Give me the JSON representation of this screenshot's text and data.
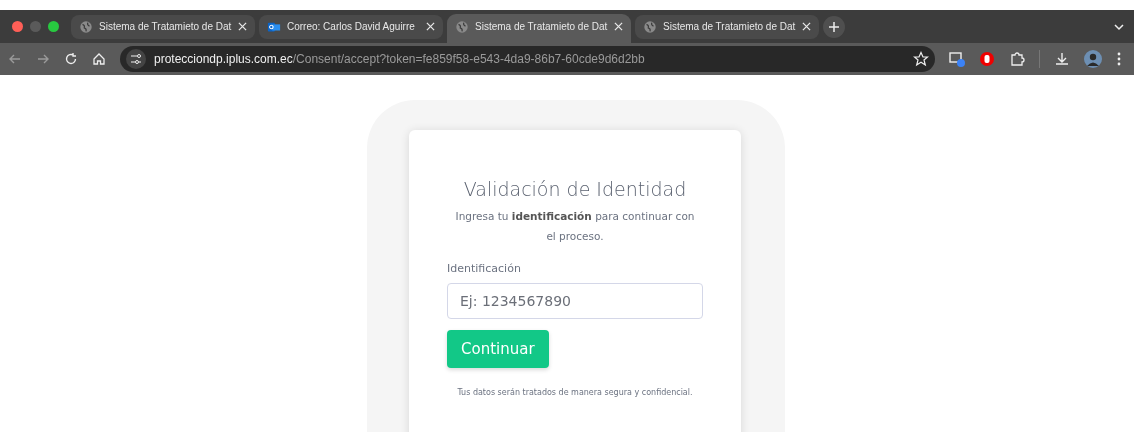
{
  "tabs": [
    {
      "title": "Sistema de Tratamieto de Dat",
      "kind": "globe",
      "selected": false
    },
    {
      "title": "Correo: Carlos David Aguirre",
      "kind": "mail",
      "selected": false
    },
    {
      "title": "Sistema de Tratamieto de Dat",
      "kind": "globe",
      "selected": true
    },
    {
      "title": "Sistema de Tratamieto de Dat",
      "kind": "globe",
      "selected": false
    }
  ],
  "address": {
    "host": "protecciondp.iplus.com.ec",
    "path": "/Consent/accept?token=fe859f58-e543-4da9-86b7-60cde9d6d2bb"
  },
  "card": {
    "title": "Validación de Identidad",
    "subtitle": "Ingresa tu **identificación** para continuar con el proceso.",
    "field_label": "Identificación",
    "placeholder": "Ej: 1234567890",
    "button": "Continuar",
    "note": "Tus datos serán tratados de manera segura y confidencial."
  }
}
